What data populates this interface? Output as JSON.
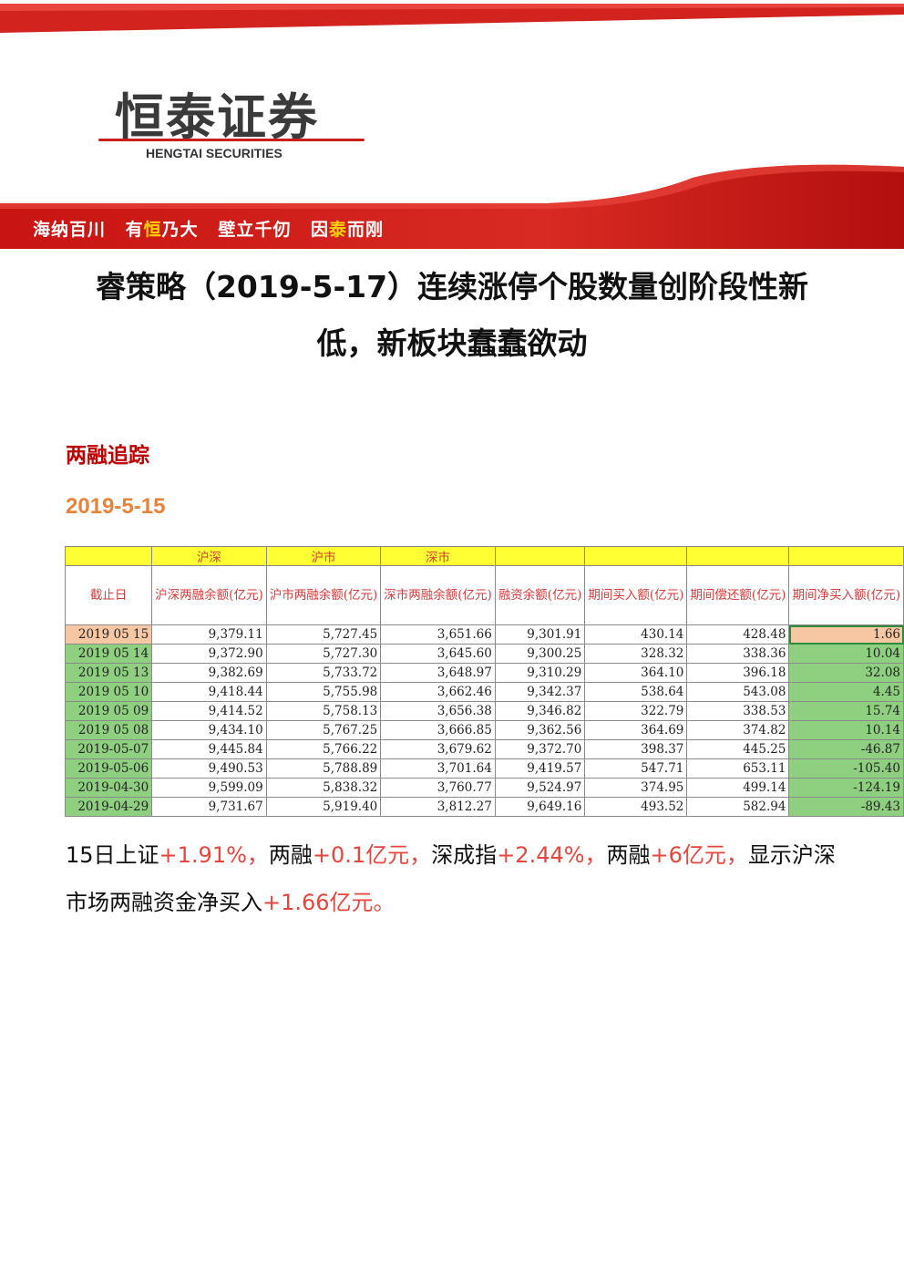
{
  "brand": {
    "logo_cn": "恒泰证券",
    "logo_en": "HENGTAI SECURITIES",
    "slogan": [
      {
        "pre": "海纳百川",
        "hl": "",
        "post": ""
      },
      {
        "pre": "有",
        "hl": "恒",
        "post": "乃大"
      },
      {
        "pre": "壁立千仞",
        "hl": "",
        "post": ""
      },
      {
        "pre": "因",
        "hl": "泰",
        "post": "而刚"
      }
    ],
    "colors": {
      "brand_red": "#c81e1e",
      "accent_yellow": "#ffd200"
    }
  },
  "doc": {
    "title_line1": "睿策略（2019-5-17）连续涨停个股数量创阶段性新",
    "title_line2": "低，新板块蠢蠢欲动",
    "section_title": "两融追踪",
    "date_heading": "2019-5-15"
  },
  "table": {
    "groups": [
      "",
      "沪深",
      "沪市",
      "深市",
      "",
      "",
      "",
      ""
    ],
    "headers": [
      "截止日",
      "沪深两融余额(亿元)",
      "沪市两融余额(亿元)",
      "深市两融余额(亿元)",
      "融资余额(亿元)",
      "期间买入额(亿元)",
      "期间偿还额(亿元)",
      "期间净买入额(亿元)"
    ],
    "rows": [
      [
        "2019 05 15",
        "9,379.11",
        "5,727.45",
        "3,651.66",
        "9,301.91",
        "430.14",
        "428.48",
        "1.66"
      ],
      [
        "2019 05 14",
        "9,372.90",
        "5,727.30",
        "3,645.60",
        "9,300.25",
        "328.32",
        "338.36",
        "10.04"
      ],
      [
        "2019 05 13",
        "9,382.69",
        "5,733.72",
        "3,648.97",
        "9,310.29",
        "364.10",
        "396.18",
        "32.08"
      ],
      [
        "2019 05 10",
        "9,418.44",
        "5,755.98",
        "3,662.46",
        "9,342.37",
        "538.64",
        "543.08",
        "4.45"
      ],
      [
        "2019 05 09",
        "9,414.52",
        "5,758.13",
        "3,656.38",
        "9,346.82",
        "322.79",
        "338.53",
        "15.74"
      ],
      [
        "2019 05 08",
        "9,434.10",
        "5,767.25",
        "3,666.85",
        "9,362.56",
        "364.69",
        "374.82",
        "10.14"
      ],
      [
        "2019-05-07",
        "9,445.84",
        "5,766.22",
        "3,679.62",
        "9,372.70",
        "398.37",
        "445.25",
        "-46.87"
      ],
      [
        "2019-05-06",
        "9,490.53",
        "5,788.89",
        "3,701.64",
        "9,419.57",
        "547.71",
        "653.11",
        "-105.40"
      ],
      [
        "2019-04-30",
        "9,599.09",
        "5,838.32",
        "3,760.77",
        "9,524.97",
        "374.95",
        "499.14",
        "-124.19"
      ],
      [
        "2019-04-29",
        "9,731.67",
        "5,919.40",
        "3,812.27",
        "9,649.16",
        "493.52",
        "582.94",
        "-89.43"
      ]
    ]
  },
  "summary": [
    {
      "text": "15日上证",
      "red": false
    },
    {
      "text": "+1.91%，",
      "red": true
    },
    {
      "text": "两融",
      "red": false
    },
    {
      "text": "+0.1亿元，",
      "red": true
    },
    {
      "text": "深成指",
      "red": false
    },
    {
      "text": "+2.44%，",
      "red": true
    },
    {
      "text": "两融",
      "red": false
    },
    {
      "text": "+6亿元，",
      "red": true
    },
    {
      "text": "显示沪深市场两融资金净买入",
      "red": false
    },
    {
      "text": "+1.66亿元。",
      "red": true
    }
  ]
}
